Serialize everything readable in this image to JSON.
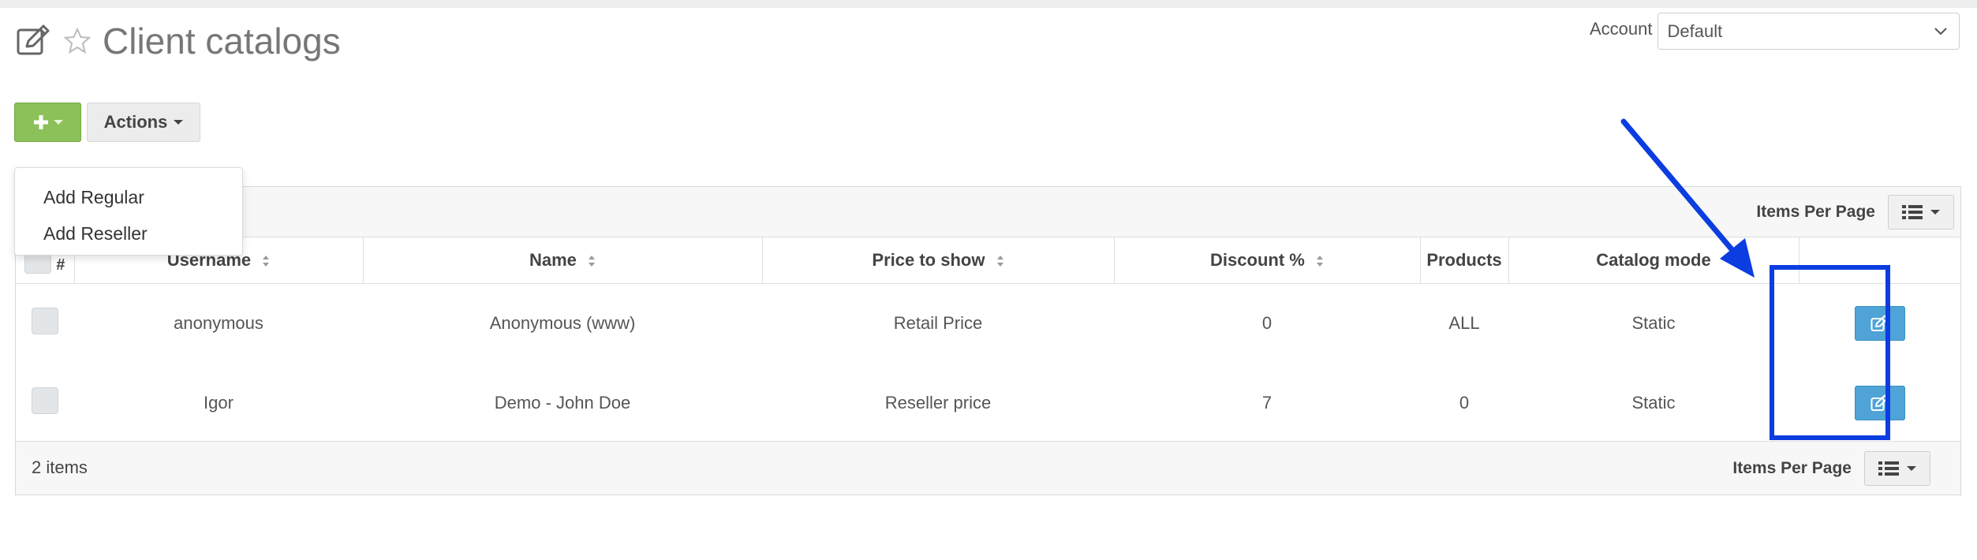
{
  "header": {
    "title": "Client catalogs",
    "edit_icon": "edit-square-icon",
    "star_icon": "star-outline-icon"
  },
  "account": {
    "label": "Account",
    "selected": "Default"
  },
  "toolbar": {
    "add_icon": "plus-icon",
    "actions_label": "Actions"
  },
  "add_menu": {
    "items": [
      "Add Regular",
      "Add Reseller"
    ]
  },
  "pagination": {
    "items_per_page_label": "Items Per Page",
    "view_icon": "list-view-icon"
  },
  "table": {
    "columns": {
      "hash": "#",
      "username": "Username",
      "name": "Name",
      "price": "Price to show",
      "discount": "Discount %",
      "products": "Products",
      "mode": "Catalog mode"
    },
    "rows": [
      {
        "username": "anonymous",
        "name": "Anonymous (www)",
        "price": "Retail Price",
        "discount": "0",
        "products": "ALL",
        "mode": "Static"
      },
      {
        "username": "Igor",
        "name": "Demo - John Doe",
        "price": "Reseller price",
        "discount": "7",
        "products": "0",
        "mode": "Static"
      }
    ]
  },
  "footer": {
    "count": "2 items"
  },
  "colors": {
    "add_button": "#8bc158",
    "edit_button": "#4fa3d6",
    "annotation": "#0b3de0"
  }
}
